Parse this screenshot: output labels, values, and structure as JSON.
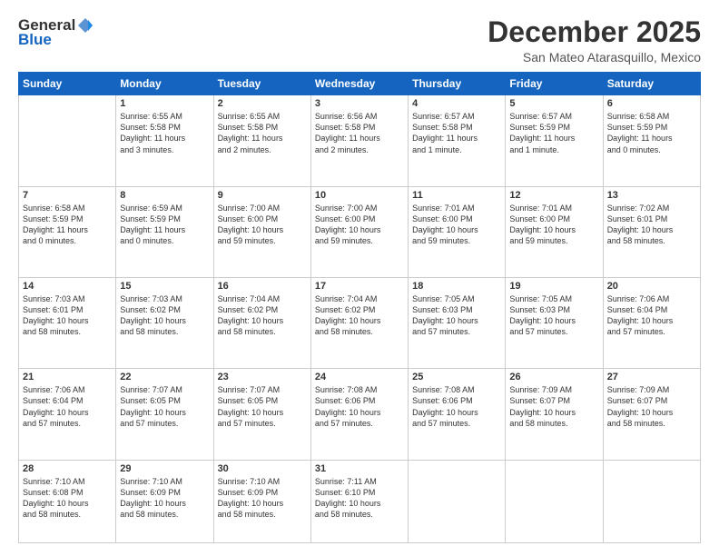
{
  "header": {
    "logo_line1": "General",
    "logo_line2": "Blue",
    "month_title": "December 2025",
    "location": "San Mateo Atarasquillo, Mexico"
  },
  "weekdays": [
    "Sunday",
    "Monday",
    "Tuesday",
    "Wednesday",
    "Thursday",
    "Friday",
    "Saturday"
  ],
  "weeks": [
    [
      {
        "day": "",
        "content": ""
      },
      {
        "day": "1",
        "content": "Sunrise: 6:55 AM\nSunset: 5:58 PM\nDaylight: 11 hours\nand 3 minutes."
      },
      {
        "day": "2",
        "content": "Sunrise: 6:55 AM\nSunset: 5:58 PM\nDaylight: 11 hours\nand 2 minutes."
      },
      {
        "day": "3",
        "content": "Sunrise: 6:56 AM\nSunset: 5:58 PM\nDaylight: 11 hours\nand 2 minutes."
      },
      {
        "day": "4",
        "content": "Sunrise: 6:57 AM\nSunset: 5:58 PM\nDaylight: 11 hours\nand 1 minute."
      },
      {
        "day": "5",
        "content": "Sunrise: 6:57 AM\nSunset: 5:59 PM\nDaylight: 11 hours\nand 1 minute."
      },
      {
        "day": "6",
        "content": "Sunrise: 6:58 AM\nSunset: 5:59 PM\nDaylight: 11 hours\nand 0 minutes."
      }
    ],
    [
      {
        "day": "7",
        "content": "Sunrise: 6:58 AM\nSunset: 5:59 PM\nDaylight: 11 hours\nand 0 minutes."
      },
      {
        "day": "8",
        "content": "Sunrise: 6:59 AM\nSunset: 5:59 PM\nDaylight: 11 hours\nand 0 minutes."
      },
      {
        "day": "9",
        "content": "Sunrise: 7:00 AM\nSunset: 6:00 PM\nDaylight: 10 hours\nand 59 minutes."
      },
      {
        "day": "10",
        "content": "Sunrise: 7:00 AM\nSunset: 6:00 PM\nDaylight: 10 hours\nand 59 minutes."
      },
      {
        "day": "11",
        "content": "Sunrise: 7:01 AM\nSunset: 6:00 PM\nDaylight: 10 hours\nand 59 minutes."
      },
      {
        "day": "12",
        "content": "Sunrise: 7:01 AM\nSunset: 6:00 PM\nDaylight: 10 hours\nand 59 minutes."
      },
      {
        "day": "13",
        "content": "Sunrise: 7:02 AM\nSunset: 6:01 PM\nDaylight: 10 hours\nand 58 minutes."
      }
    ],
    [
      {
        "day": "14",
        "content": "Sunrise: 7:03 AM\nSunset: 6:01 PM\nDaylight: 10 hours\nand 58 minutes."
      },
      {
        "day": "15",
        "content": "Sunrise: 7:03 AM\nSunset: 6:02 PM\nDaylight: 10 hours\nand 58 minutes."
      },
      {
        "day": "16",
        "content": "Sunrise: 7:04 AM\nSunset: 6:02 PM\nDaylight: 10 hours\nand 58 minutes."
      },
      {
        "day": "17",
        "content": "Sunrise: 7:04 AM\nSunset: 6:02 PM\nDaylight: 10 hours\nand 58 minutes."
      },
      {
        "day": "18",
        "content": "Sunrise: 7:05 AM\nSunset: 6:03 PM\nDaylight: 10 hours\nand 57 minutes."
      },
      {
        "day": "19",
        "content": "Sunrise: 7:05 AM\nSunset: 6:03 PM\nDaylight: 10 hours\nand 57 minutes."
      },
      {
        "day": "20",
        "content": "Sunrise: 7:06 AM\nSunset: 6:04 PM\nDaylight: 10 hours\nand 57 minutes."
      }
    ],
    [
      {
        "day": "21",
        "content": "Sunrise: 7:06 AM\nSunset: 6:04 PM\nDaylight: 10 hours\nand 57 minutes."
      },
      {
        "day": "22",
        "content": "Sunrise: 7:07 AM\nSunset: 6:05 PM\nDaylight: 10 hours\nand 57 minutes."
      },
      {
        "day": "23",
        "content": "Sunrise: 7:07 AM\nSunset: 6:05 PM\nDaylight: 10 hours\nand 57 minutes."
      },
      {
        "day": "24",
        "content": "Sunrise: 7:08 AM\nSunset: 6:06 PM\nDaylight: 10 hours\nand 57 minutes."
      },
      {
        "day": "25",
        "content": "Sunrise: 7:08 AM\nSunset: 6:06 PM\nDaylight: 10 hours\nand 57 minutes."
      },
      {
        "day": "26",
        "content": "Sunrise: 7:09 AM\nSunset: 6:07 PM\nDaylight: 10 hours\nand 58 minutes."
      },
      {
        "day": "27",
        "content": "Sunrise: 7:09 AM\nSunset: 6:07 PM\nDaylight: 10 hours\nand 58 minutes."
      }
    ],
    [
      {
        "day": "28",
        "content": "Sunrise: 7:10 AM\nSunset: 6:08 PM\nDaylight: 10 hours\nand 58 minutes."
      },
      {
        "day": "29",
        "content": "Sunrise: 7:10 AM\nSunset: 6:09 PM\nDaylight: 10 hours\nand 58 minutes."
      },
      {
        "day": "30",
        "content": "Sunrise: 7:10 AM\nSunset: 6:09 PM\nDaylight: 10 hours\nand 58 minutes."
      },
      {
        "day": "31",
        "content": "Sunrise: 7:11 AM\nSunset: 6:10 PM\nDaylight: 10 hours\nand 58 minutes."
      },
      {
        "day": "",
        "content": ""
      },
      {
        "day": "",
        "content": ""
      },
      {
        "day": "",
        "content": ""
      }
    ]
  ]
}
